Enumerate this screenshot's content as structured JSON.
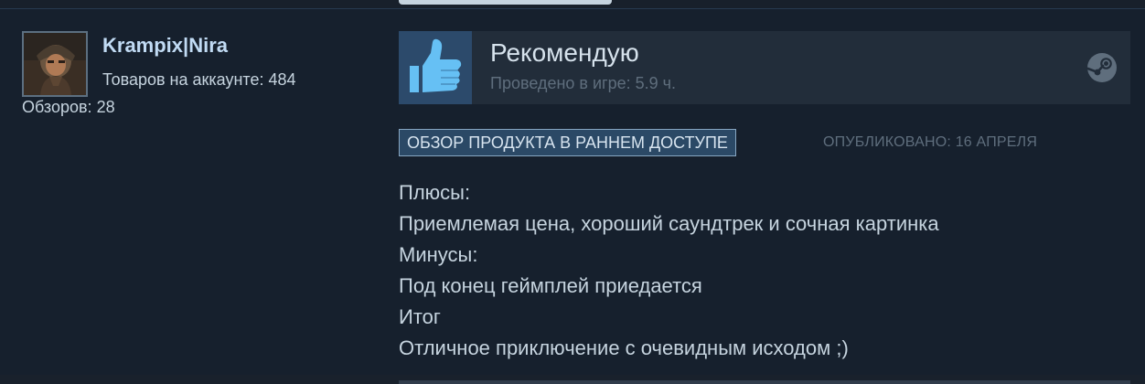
{
  "author": {
    "name": "Krampix|Nira",
    "products_label": "Товаров на аккаунте: 484",
    "reviews_label": "Обзоров: 28"
  },
  "review": {
    "verdict": "Рекомендую",
    "playtime": "Проведено в игре: 5.9 ч.",
    "early_access_label": "ОБЗОР ПРОДУКТА В РАННЕМ ДОСТУПЕ",
    "published": "ОПУБЛИКОВАНО: 16 АПРЕЛЯ",
    "lines": [
      "Плюсы:",
      "Приемлемая цена, хороший саундтрек и сочная картинка",
      "Минусы:",
      "Под конец геймплей приедается",
      "Итог",
      "Отличное приключение с очевидным исходом ;)"
    ]
  },
  "icons": {
    "thumb": "thumbs-up-icon",
    "platform": "steam-icon"
  },
  "colors": {
    "background": "#16202d",
    "username": "#c1dbf4",
    "text": "#c6d4df",
    "muted": "#5f6e7d",
    "thumb_box": "#2c4a6b",
    "thumb": "#66c0f4",
    "badge_bg": "#2b4966",
    "badge_border": "#87a6c2"
  }
}
